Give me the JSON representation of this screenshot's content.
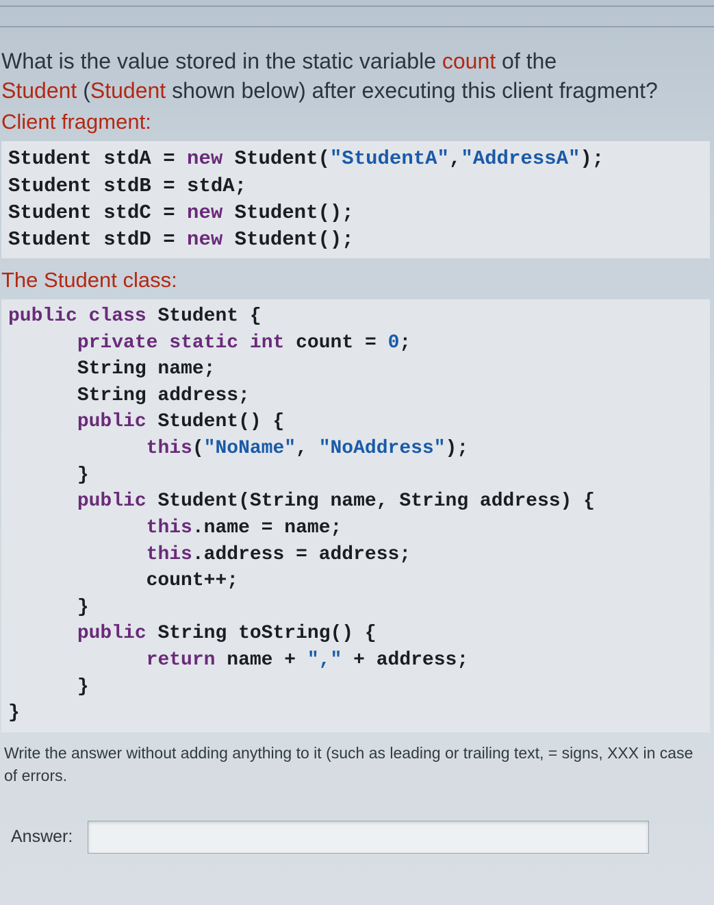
{
  "question": {
    "line1_pre": "What is the value stored in the static variable ",
    "line1_highlight": "count",
    "line1_post": " of the",
    "line2_hl1": "Student",
    "line2_mid": " (",
    "line2_hl2": "Student",
    "line2_post": " shown below) after executing this client fragment?"
  },
  "section_client": "Client fragment:",
  "client_code": {
    "l1_a": "Student stdA = ",
    "l1_kw": "new",
    "l1_b": " Student(",
    "l1_s1": "\"StudentA\"",
    "l1_c": ",",
    "l1_s2": "\"AddressA\"",
    "l1_d": ");",
    "l2": "Student stdB = stdA;",
    "l3_a": "Student stdC = ",
    "l3_kw": "new",
    "l3_b": " Student();",
    "l4_a": "Student stdD = ",
    "l4_kw": "new",
    "l4_b": " Student();"
  },
  "section_class": "The Student class:",
  "class_code": {
    "l1_kw1": "public",
    "l1_sp1": " ",
    "l1_kw2": "class",
    "l1_b": " Student {",
    "l2_a": "      ",
    "l2_kw1": "private",
    "l2_sp1": " ",
    "l2_kw2": "static",
    "l2_sp2": " ",
    "l2_kw3": "int",
    "l2_b": " count = ",
    "l2_num": "0",
    "l2_c": ";",
    "l3": "      String name;",
    "l4": "      String address;",
    "l5_a": "      ",
    "l5_kw": "public",
    "l5_b": " Student() {",
    "l6_a": "            ",
    "l6_kw": "this",
    "l6_b": "(",
    "l6_s1": "\"NoName\"",
    "l6_c": ", ",
    "l6_s2": "\"NoAddress\"",
    "l6_d": ");",
    "l7": "      }",
    "l8_a": "      ",
    "l8_kw": "public",
    "l8_b": " Student(String name, String address) {",
    "l9_a": "            ",
    "l9_kw": "this",
    "l9_b": ".name = name;",
    "l10_a": "            ",
    "l10_kw": "this",
    "l10_b": ".address = address;",
    "l11": "            count++;",
    "l12": "      }",
    "l13_a": "      ",
    "l13_kw": "public",
    "l13_b": " String toString() {",
    "l14_a": "            ",
    "l14_kw": "return",
    "l14_b": " name + ",
    "l14_s": "\",\"",
    "l14_c": " + address;",
    "l15": "      }",
    "l16": "}"
  },
  "instructions": "Write the answer without adding anything to it (such as leading or trailing text, = signs, XXX in case of errors.",
  "answer_label": "Answer:",
  "answer_value": ""
}
